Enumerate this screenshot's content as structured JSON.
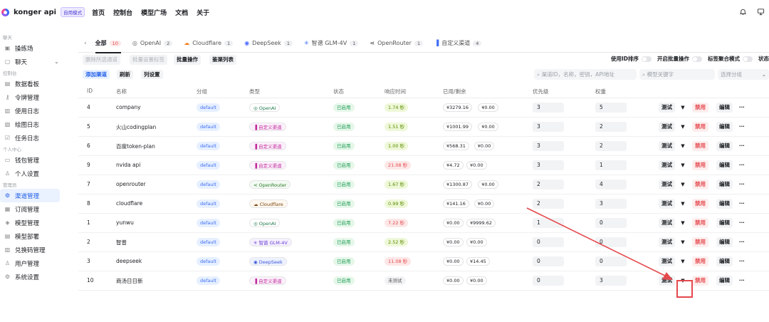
{
  "header": {
    "brand": "konger api",
    "mode_badge": "自用模式",
    "nav": [
      "首页",
      "控制台",
      "模型广场",
      "文档",
      "关于"
    ]
  },
  "sidebar": {
    "sections": [
      {
        "title": "聊天",
        "items": [
          {
            "label": "操练场",
            "icon": "playground-icon"
          },
          {
            "label": "聊天",
            "icon": "chat-icon",
            "chevron": true
          }
        ]
      },
      {
        "title": "控制台",
        "items": [
          {
            "label": "数据看板",
            "icon": "dashboard-icon"
          },
          {
            "label": "令牌管理",
            "icon": "key-icon"
          },
          {
            "label": "使用日志",
            "icon": "log-icon"
          },
          {
            "label": "绘图日志",
            "icon": "image-icon"
          },
          {
            "label": "任务日志",
            "icon": "task-icon"
          }
        ]
      },
      {
        "title": "个人中心",
        "items": [
          {
            "label": "钱包管理",
            "icon": "wallet-icon"
          },
          {
            "label": "个人设置",
            "icon": "user-icon"
          }
        ]
      },
      {
        "title": "管理员",
        "items": [
          {
            "label": "渠道管理",
            "icon": "channel-icon",
            "active": true
          },
          {
            "label": "订阅管理",
            "icon": "subscription-icon"
          },
          {
            "label": "模型管理",
            "icon": "model-icon"
          },
          {
            "label": "模型部署",
            "icon": "deploy-icon"
          },
          {
            "label": "兑换码管理",
            "icon": "redeem-icon"
          },
          {
            "label": "用户管理",
            "icon": "users-icon"
          },
          {
            "label": "系统设置",
            "icon": "settings-icon"
          }
        ]
      }
    ]
  },
  "tabs": [
    {
      "label": "全部",
      "count": "10",
      "active": true
    },
    {
      "label": "OpenAI",
      "count": "2",
      "icon": "openai-icon"
    },
    {
      "label": "Cloudflare",
      "count": "1",
      "icon": "cloudflare-icon"
    },
    {
      "label": "DeepSeek",
      "count": "1",
      "icon": "deepseek-icon"
    },
    {
      "label": "智谱 GLM-4V",
      "count": "1",
      "icon": "zhipu-icon"
    },
    {
      "label": "OpenRouter",
      "count": "1",
      "icon": "openrouter-icon"
    },
    {
      "label": "自定义渠道",
      "count": "4",
      "icon": "custom-icon"
    }
  ],
  "toolbar1": {
    "delete_disabled": "删除所选通道",
    "batch_tag": "批量设置标签",
    "batch_ops": "批量操作",
    "tag_list": "鉴渠列表",
    "toggles": [
      "使用ID排序",
      "开启批量操作",
      "标签聚合模式",
      "状态"
    ]
  },
  "toolbar2": {
    "add": "添加渠道",
    "refresh": "刷新",
    "columns": "列设置",
    "search_placeholder": "渠道ID，名称，密钥，API地址",
    "model_placeholder": "模型关键字",
    "group_select": "选择分组"
  },
  "table": {
    "headers": [
      "ID",
      "名称",
      "分组",
      "类型",
      "状态",
      "响应时间",
      "已用/剩余",
      "优先级",
      "权重"
    ],
    "rows": [
      {
        "id": "4",
        "name": "company",
        "group": "default",
        "type": "OpenAI",
        "type_icon": "openai",
        "status": "已启用",
        "resp": "1.74 秒",
        "resp_level": "ok",
        "used": "¥3279.16",
        "remain": "¥0.00",
        "priority": "3",
        "weight": "5"
      },
      {
        "id": "5",
        "name": "火山codingplan",
        "group": "default",
        "type": "自定义渠道",
        "type_icon": "custom",
        "status": "已启用",
        "resp": "1.51 秒",
        "resp_level": "ok",
        "used": "¥1001.99",
        "remain": "¥0.00",
        "priority": "3",
        "weight": "2"
      },
      {
        "id": "6",
        "name": "百度token-plan",
        "group": "default",
        "type": "自定义渠道",
        "type_icon": "custom",
        "status": "已启用",
        "resp": "1.00 秒",
        "resp_level": "ok",
        "used": "¥568.31",
        "remain": "¥0.00",
        "priority": "3",
        "weight": "2"
      },
      {
        "id": "9",
        "name": "nvida api",
        "group": "default",
        "type": "自定义渠道",
        "type_icon": "custom",
        "status": "已启用",
        "resp": "21.08 秒",
        "resp_level": "slow",
        "used": "¥4.72",
        "remain": "¥0.00",
        "priority": "3",
        "weight": "1"
      },
      {
        "id": "7",
        "name": "openrouter",
        "group": "default",
        "type": "OpenRouter",
        "type_icon": "openrouter",
        "status": "已启用",
        "resp": "1.67 秒",
        "resp_level": "ok",
        "used": "¥1300.87",
        "remain": "¥0.00",
        "priority": "2",
        "weight": "4"
      },
      {
        "id": "8",
        "name": "cloudflare",
        "group": "default",
        "type": "Cloudflare",
        "type_icon": "cloudflare",
        "status": "已启用",
        "resp": "0.99 秒",
        "resp_level": "ok",
        "used": "¥141.16",
        "remain": "¥0.00",
        "priority": "2",
        "weight": "3"
      },
      {
        "id": "1",
        "name": "yunwu",
        "group": "default",
        "type": "OpenAI",
        "type_icon": "openai",
        "status": "已启用",
        "resp": "7.22 秒",
        "resp_level": "slow",
        "used": "¥0.00",
        "remain": "¥9999.62",
        "priority": "1",
        "weight": "0"
      },
      {
        "id": "2",
        "name": "智普",
        "group": "default",
        "type": "智谱 GLM-4V",
        "type_icon": "zhipu",
        "status": "已启用",
        "resp": "2.52 秒",
        "resp_level": "ok",
        "used": "¥0.00",
        "remain": "¥0.00",
        "priority": "0",
        "weight": "0"
      },
      {
        "id": "3",
        "name": "deepseek",
        "group": "default",
        "type": "DeepSeek",
        "type_icon": "deepseek",
        "status": "已启用",
        "resp": "11.08 秒",
        "resp_level": "slow",
        "used": "¥0.00",
        "remain": "¥14.45",
        "priority": "0",
        "weight": "0"
      },
      {
        "id": "10",
        "name": "商汤日日新",
        "group": "default",
        "type": "自定义渠道",
        "type_icon": "custom",
        "status": "已启用",
        "resp": "未测试",
        "resp_level": "none",
        "used": "¥0.00",
        "remain": "¥0.00",
        "priority": "0",
        "weight": "3"
      }
    ],
    "actions": {
      "test": "测试",
      "disable": "禁用",
      "edit": "编辑"
    }
  },
  "colors": {
    "accent": "#2461e8",
    "danger": "#e5484d",
    "success": "#1f9d55"
  }
}
